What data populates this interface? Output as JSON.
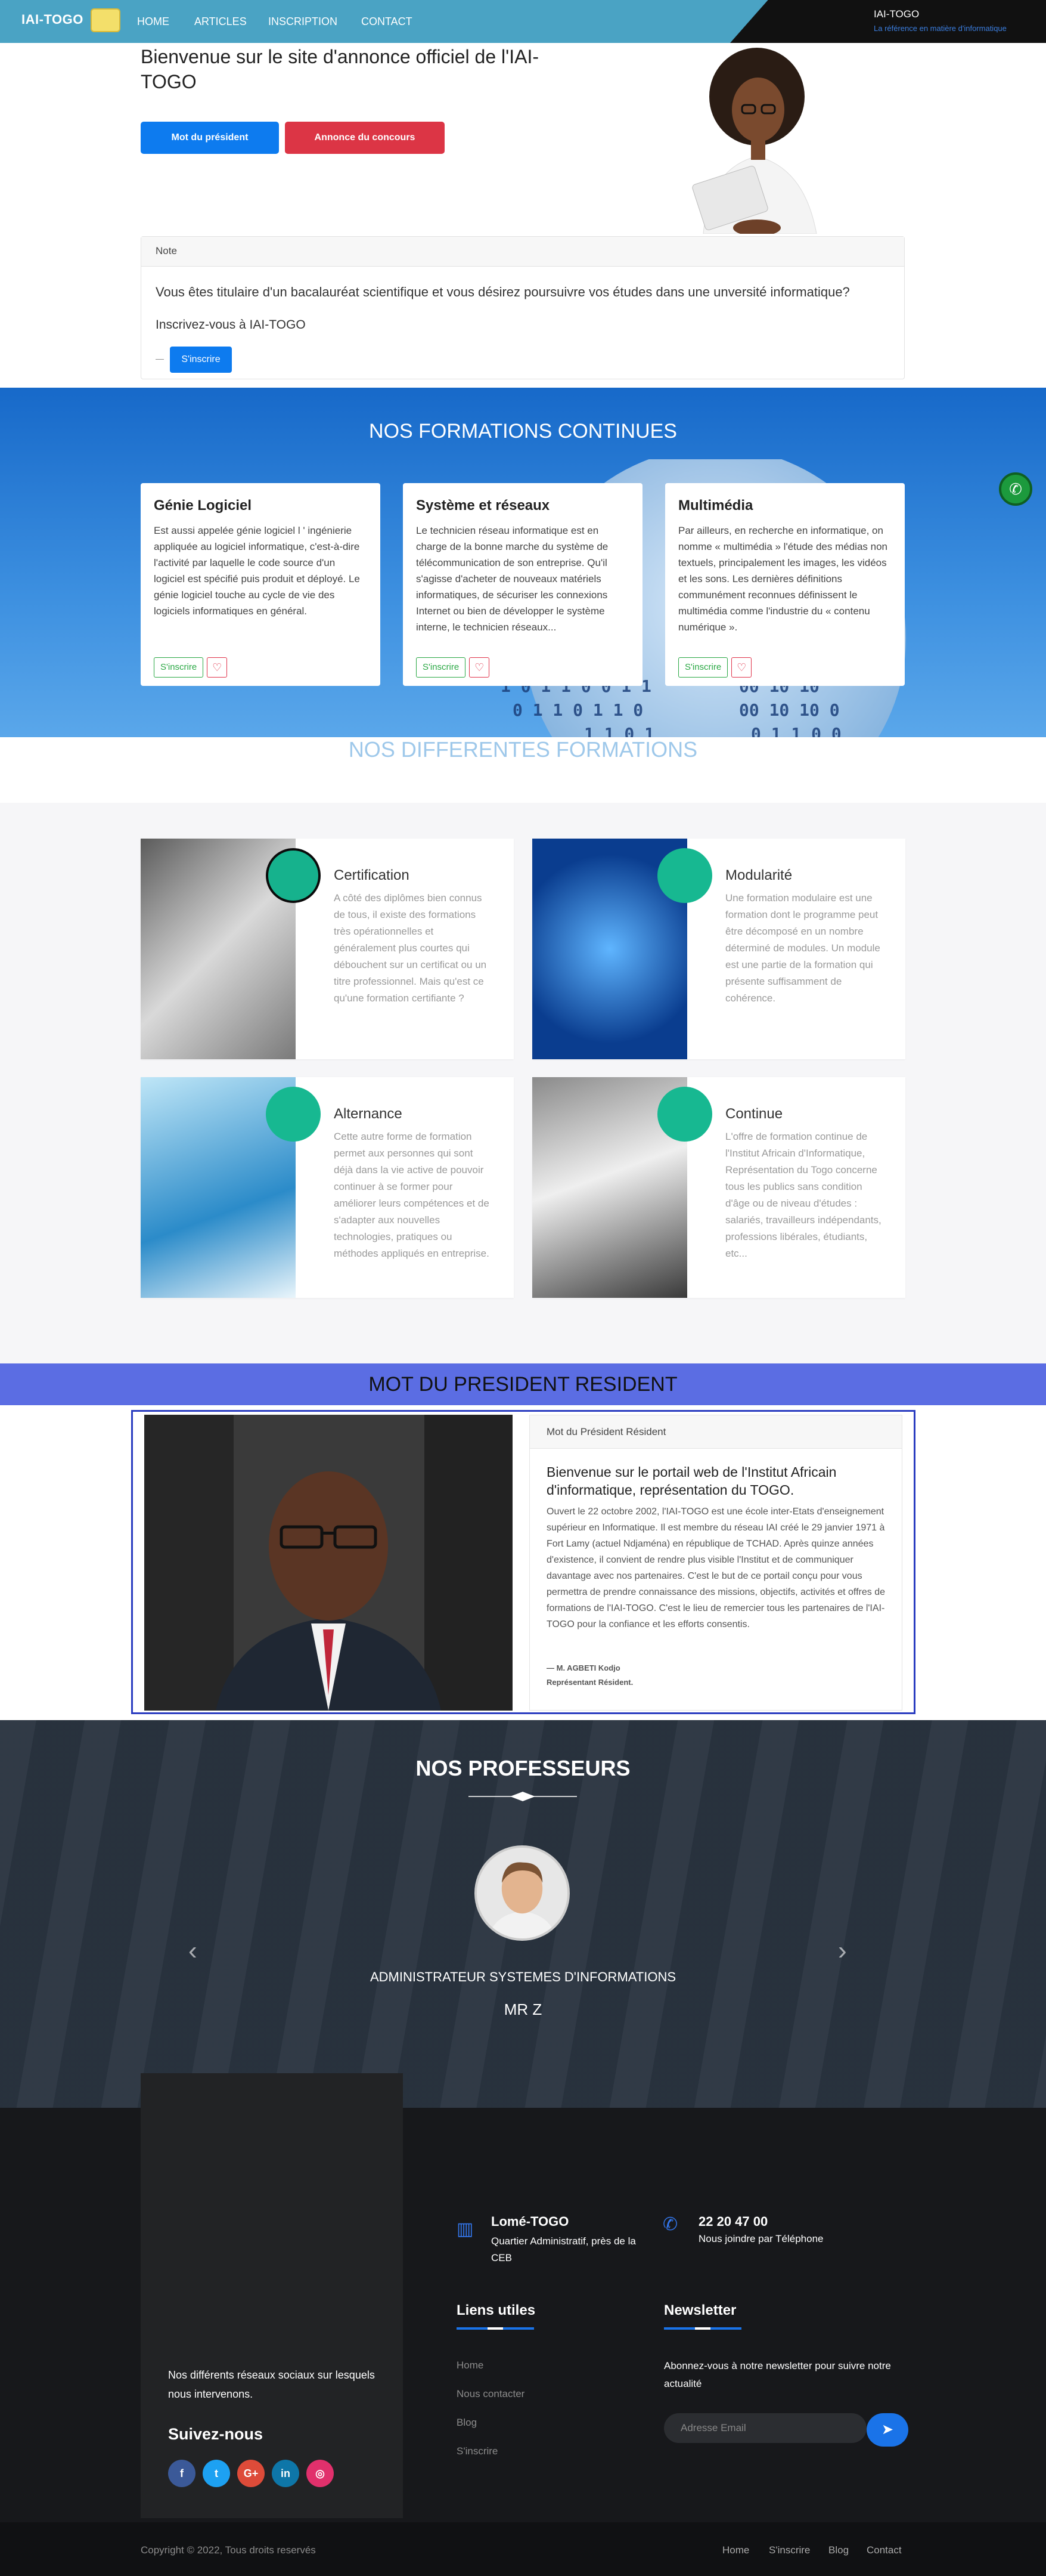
{
  "nav": {
    "brand": "IAI-TOGO",
    "links": [
      "HOME",
      "ARTICLES",
      "INSCRIPTION",
      "CONTACT"
    ],
    "right_title": "IAI-TOGO",
    "right_subtitle": "La référence en matière d'informatique"
  },
  "hero": {
    "title": "Bienvenue sur le site d'annonce officiel de l'IAI-TOGO",
    "btn_president": "Mot du président",
    "btn_concours": "Annonce du concours"
  },
  "note": {
    "header": "Note",
    "body": "Vous êtes titulaire d'un bacalauréat scientifique et vous désirez poursuivre vos études dans une unversité informatique?",
    "sub": "Inscrivez-vous à IAI-TOGO",
    "btn": "S'inscrire"
  },
  "formations_continues": {
    "title": "NOS FORMATIONS CONTINUES",
    "cards": [
      {
        "title": "Génie Logiciel",
        "text": "Est aussi appelée génie logiciel l ' ingénierie appliquée au logiciel informatique, c'est-à-dire l'activité par laquelle le code source d'un logiciel est spécifié puis produit et déployé. Le génie logiciel touche au cycle de vie des logiciels informatiques en général.",
        "btn": "S'inscrire"
      },
      {
        "title": "Système et réseaux",
        "text": "Le technicien réseau informatique est en charge de la bonne marche du système de télécommunication de son entreprise. Qu'il s'agisse d'acheter de nouveaux matériels informatiques, de sécuriser les connexions Internet ou bien de développer le système interne, le technicien réseaux...",
        "btn": "S'inscrire"
      },
      {
        "title": "Multimédia",
        "text": "Par ailleurs, en recherche en informatique, on nomme « multimédia » l'étude des médias non textuels, principalement les images, les vidéos et les sons. Les dernières définitions communément reconnues définissent le multimédia comme l'industrie du « contenu numérique ».",
        "btn": "S'inscrire"
      }
    ]
  },
  "differentes": {
    "title": "NOS DIFFERENTES FORMATIONS",
    "cards": [
      {
        "title": "Certification",
        "text": "A côté des diplômes bien connus de tous, il existe des formations très opérationnelles et généralement plus courtes qui débouchent sur un certificat ou un titre professionnel. Mais qu'est ce qu'une formation certifiante ?",
        "icon": "badge-icon"
      },
      {
        "title": "Modularité",
        "text": "Une formation modulaire est une formation dont le programme peut être décomposé en un nombre déterminé de modules. Un module est une partie de la formation qui présente suffisamment de cohérence.",
        "icon": "puzzle-icon"
      },
      {
        "title": "Alternance",
        "text": "Cette autre forme de formation permet aux personnes qui sont déjà dans la vie active de pouvoir continuer à se former pour améliorer leurs compétences et de s'adapter aux nouvelles technologies, pratiques ou méthodes appliqués en entreprise.",
        "icon": "people-icon"
      },
      {
        "title": "Continue",
        "text": "L'offre de formation continue de l'Institut Africain d'Informatique, Représentation du Togo concerne tous les publics sans condition d'âge ou de niveau d'études : salariés, travailleurs indépendants, professions libérales, étudiants, etc...",
        "icon": "book-icon"
      }
    ]
  },
  "president": {
    "bar_title": "MOT DU PRESIDENT RESIDENT",
    "card_header": "Mot du Président Résident",
    "heading": "Bienvenue sur le portail web de l'Institut Africain d'informatique, représentation du TOGO.",
    "text": "Ouvert le 22 octobre 2002, l'IAI-TOGO est une école inter-Etats d'enseignement supérieur en Informatique. Il est membre du réseau IAI créé le 29 janvier 1971 à Fort Lamy (actuel Ndjaména) en république de TCHAD. Après quinze années d'existence, il convient de rendre plus visible l'Institut et de communiquer davantage avec nos partenaires. C'est le but de ce portail conçu pour vous permettra de prendre connaissance des missions, objectifs, activités et offres de formations de l'IAI-TOGO. C'est le lieu de remercier tous les partenaires de l'IAI-TOGO pour la confiance et les efforts consentis.",
    "sig_name": "— M. AGBETI Kodjo",
    "sig_role": "Représentant Résident."
  },
  "profs": {
    "title": "NOS PROFESSEURS",
    "role": "ADMINISTRATEUR SYSTEMES D'INFORMATIONS",
    "name": "MR Z",
    "prev": "‹",
    "next": "›"
  },
  "footer": {
    "social_text": "Nos différents réseaux sociaux sur lesquels nous intervenons.",
    "suivez": "Suivez-nous",
    "social": [
      {
        "icon": "facebook-icon",
        "label": "f",
        "color": "#3b5998"
      },
      {
        "icon": "twitter-icon",
        "label": "t",
        "color": "#1da1f2"
      },
      {
        "icon": "google-plus-icon",
        "label": "G+",
        "color": "#dd4b39"
      },
      {
        "icon": "linkedin-icon",
        "label": "in",
        "color": "#0e76a8"
      },
      {
        "icon": "instagram-icon",
        "label": "◎",
        "color": "#e1306c"
      }
    ],
    "address_title": "Lomé-TOGO",
    "address_text": "Quartier Administratif, près de la CEB",
    "phone_title": "22 20 47 00",
    "phone_text": "Nous joindre par Téléphone",
    "links_title": "Liens utiles",
    "links": [
      "Home",
      "Nous contacter",
      "Blog",
      "S'inscrire"
    ],
    "news_title": "Newsletter",
    "news_text": "Abonnez-vous à notre newsletter pour suivre notre actualité",
    "news_placeholder": "Adresse Email",
    "copyright": "Copyright © 2022, Tous droits reservés",
    "bottom_links": [
      "Home",
      "S'inscrire",
      "Blog",
      "Contact"
    ]
  }
}
